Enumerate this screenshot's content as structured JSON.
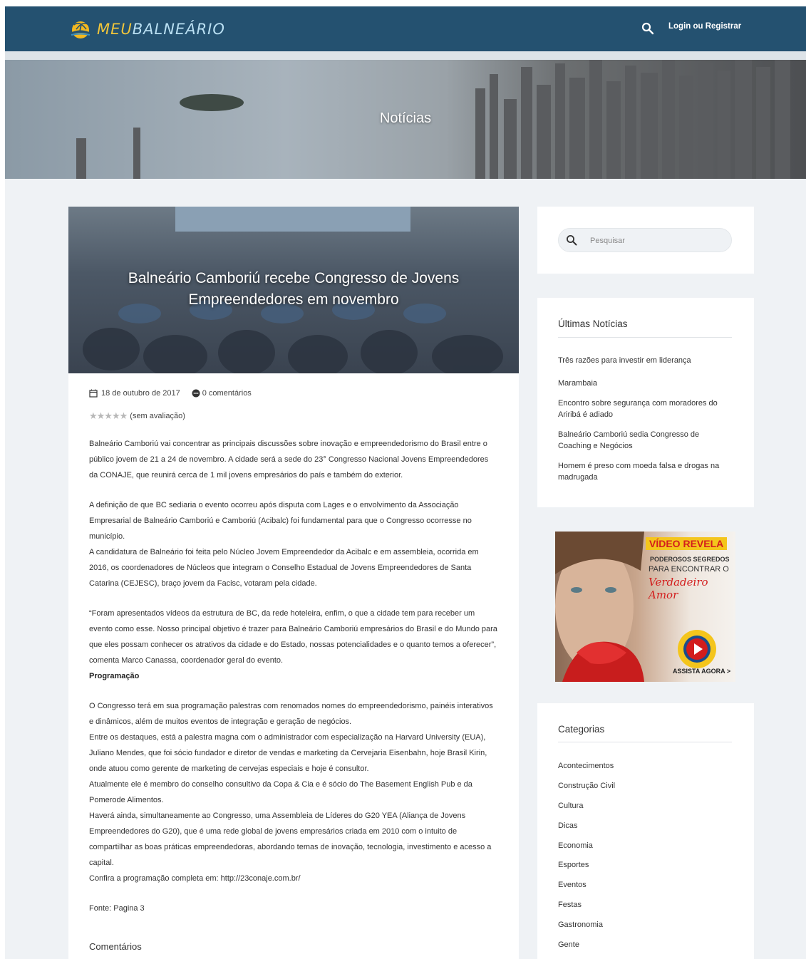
{
  "header": {
    "logo_part1": "MEU",
    "logo_part2": "BALNEÁRIO",
    "login_label": "Login ou Registrar"
  },
  "hero": {
    "title": "Notícias"
  },
  "article": {
    "title": "Balneário Camboriú recebe Congresso de Jovens Empreendedores em novembro",
    "date": "18 de outubro de 2017",
    "comments": "0 comentários",
    "rating_stars": "★★★★★",
    "rating_label": "(sem avaliação)",
    "paragraphs": [
      "Balneário Camboriú vai concentrar as principais discussões sobre inovação e empreendedorismo do Brasil entre o público jovem de 21 a 24 de novembro. A cidade será a sede do 23° Congresso Nacional Jovens Empreendedores da CONAJE, que reunirá cerca de 1 mil jovens empresários do país e também do exterior.",
      "A definição de que BC sediaria o evento ocorreu após disputa com Lages e o envolvimento da Associação Empresarial de Balneário Camboriú e Camboriú (Acibalc) foi fundamental para que o Congresso ocorresse no município.",
      "A candidatura de Balneário foi feita pelo Núcleo Jovem Empreendedor da Acibalc e em assembleia, ocorrida em 2016, os coordenadores de Núcleos que integram o Conselho Estadual de Jovens Empreendedores de Santa Catarina (CEJESC), braço jovem da Facisc, votaram pela cidade.",
      "“Foram apresentados vídeos da estrutura de BC, da rede hoteleira, enfim, o que a cidade tem para receber um evento como esse. Nosso principal objetivo é trazer para Balneário Camboriú empresários do Brasil e do Mundo para que eles possam conhecer os atrativos da cidade e do Estado, nossas potencialidades e o quanto temos a oferecer”, comenta Marco Canassa, coordenador geral do evento.",
      "Programação",
      "O Congresso terá em sua programação palestras com renomados nomes do empreendedorismo, painéis interativos e dinâmicos, além de muitos eventos de integração e geração de negócios.",
      "Entre os destaques, está a palestra magna com o administrador com especialização na Harvard University (EUA), Juliano Mendes, que foi sócio fundador e diretor de vendas e marketing da Cervejaria Eisenbahn, hoje Brasil Kirin, onde atuou como gerente de marketing de cervejas especiais e hoje é consultor.",
      "Atualmente ele é membro do conselho consultivo da Copa & Cia e é sócio do The Basement English Pub e da Pomerode Alimentos.",
      "Haverá ainda, simultaneamente ao Congresso, uma Assembleia de Líderes do G20 YEA (Aliança de Jovens Empreendedores do G20), que é uma rede global de jovens empresários criada em 2010 com o intuito de compartilhar as boas práticas empreendedoras, abordando temas de inovação, tecnologia, investimento e acesso a capital.",
      "Confira a programação completa em: http://23conaje.com.br/",
      "Fonte: Pagina 3"
    ],
    "comments_heading": "Comentários"
  },
  "sidebar": {
    "search_placeholder": "Pesquisar",
    "latest_title": "Últimas Notícias",
    "latest_items": [
      "Três razões para investir em liderança",
      "Marambaia",
      "Encontro sobre segurança com moradores do Ariribá é adiado",
      "Balneário Camboriú sedia Congresso de Coaching e Negócios",
      "Homem é preso com moeda falsa e drogas na madrugada"
    ],
    "ad": {
      "title": "VÍDEO REVELA",
      "line2": "PODEROSOS SEGREDOS",
      "line3": "PARA ENCONTRAR O",
      "line4": "Verdadeiro Amor",
      "cta": "ASSISTA AGORA >"
    },
    "categories_title": "Categorias",
    "categories": [
      "Acontecimentos",
      "Construção Civil",
      "Cultura",
      "Dicas",
      "Economia",
      "Esportes",
      "Eventos",
      "Festas",
      "Gastronomia",
      "Gente"
    ]
  }
}
